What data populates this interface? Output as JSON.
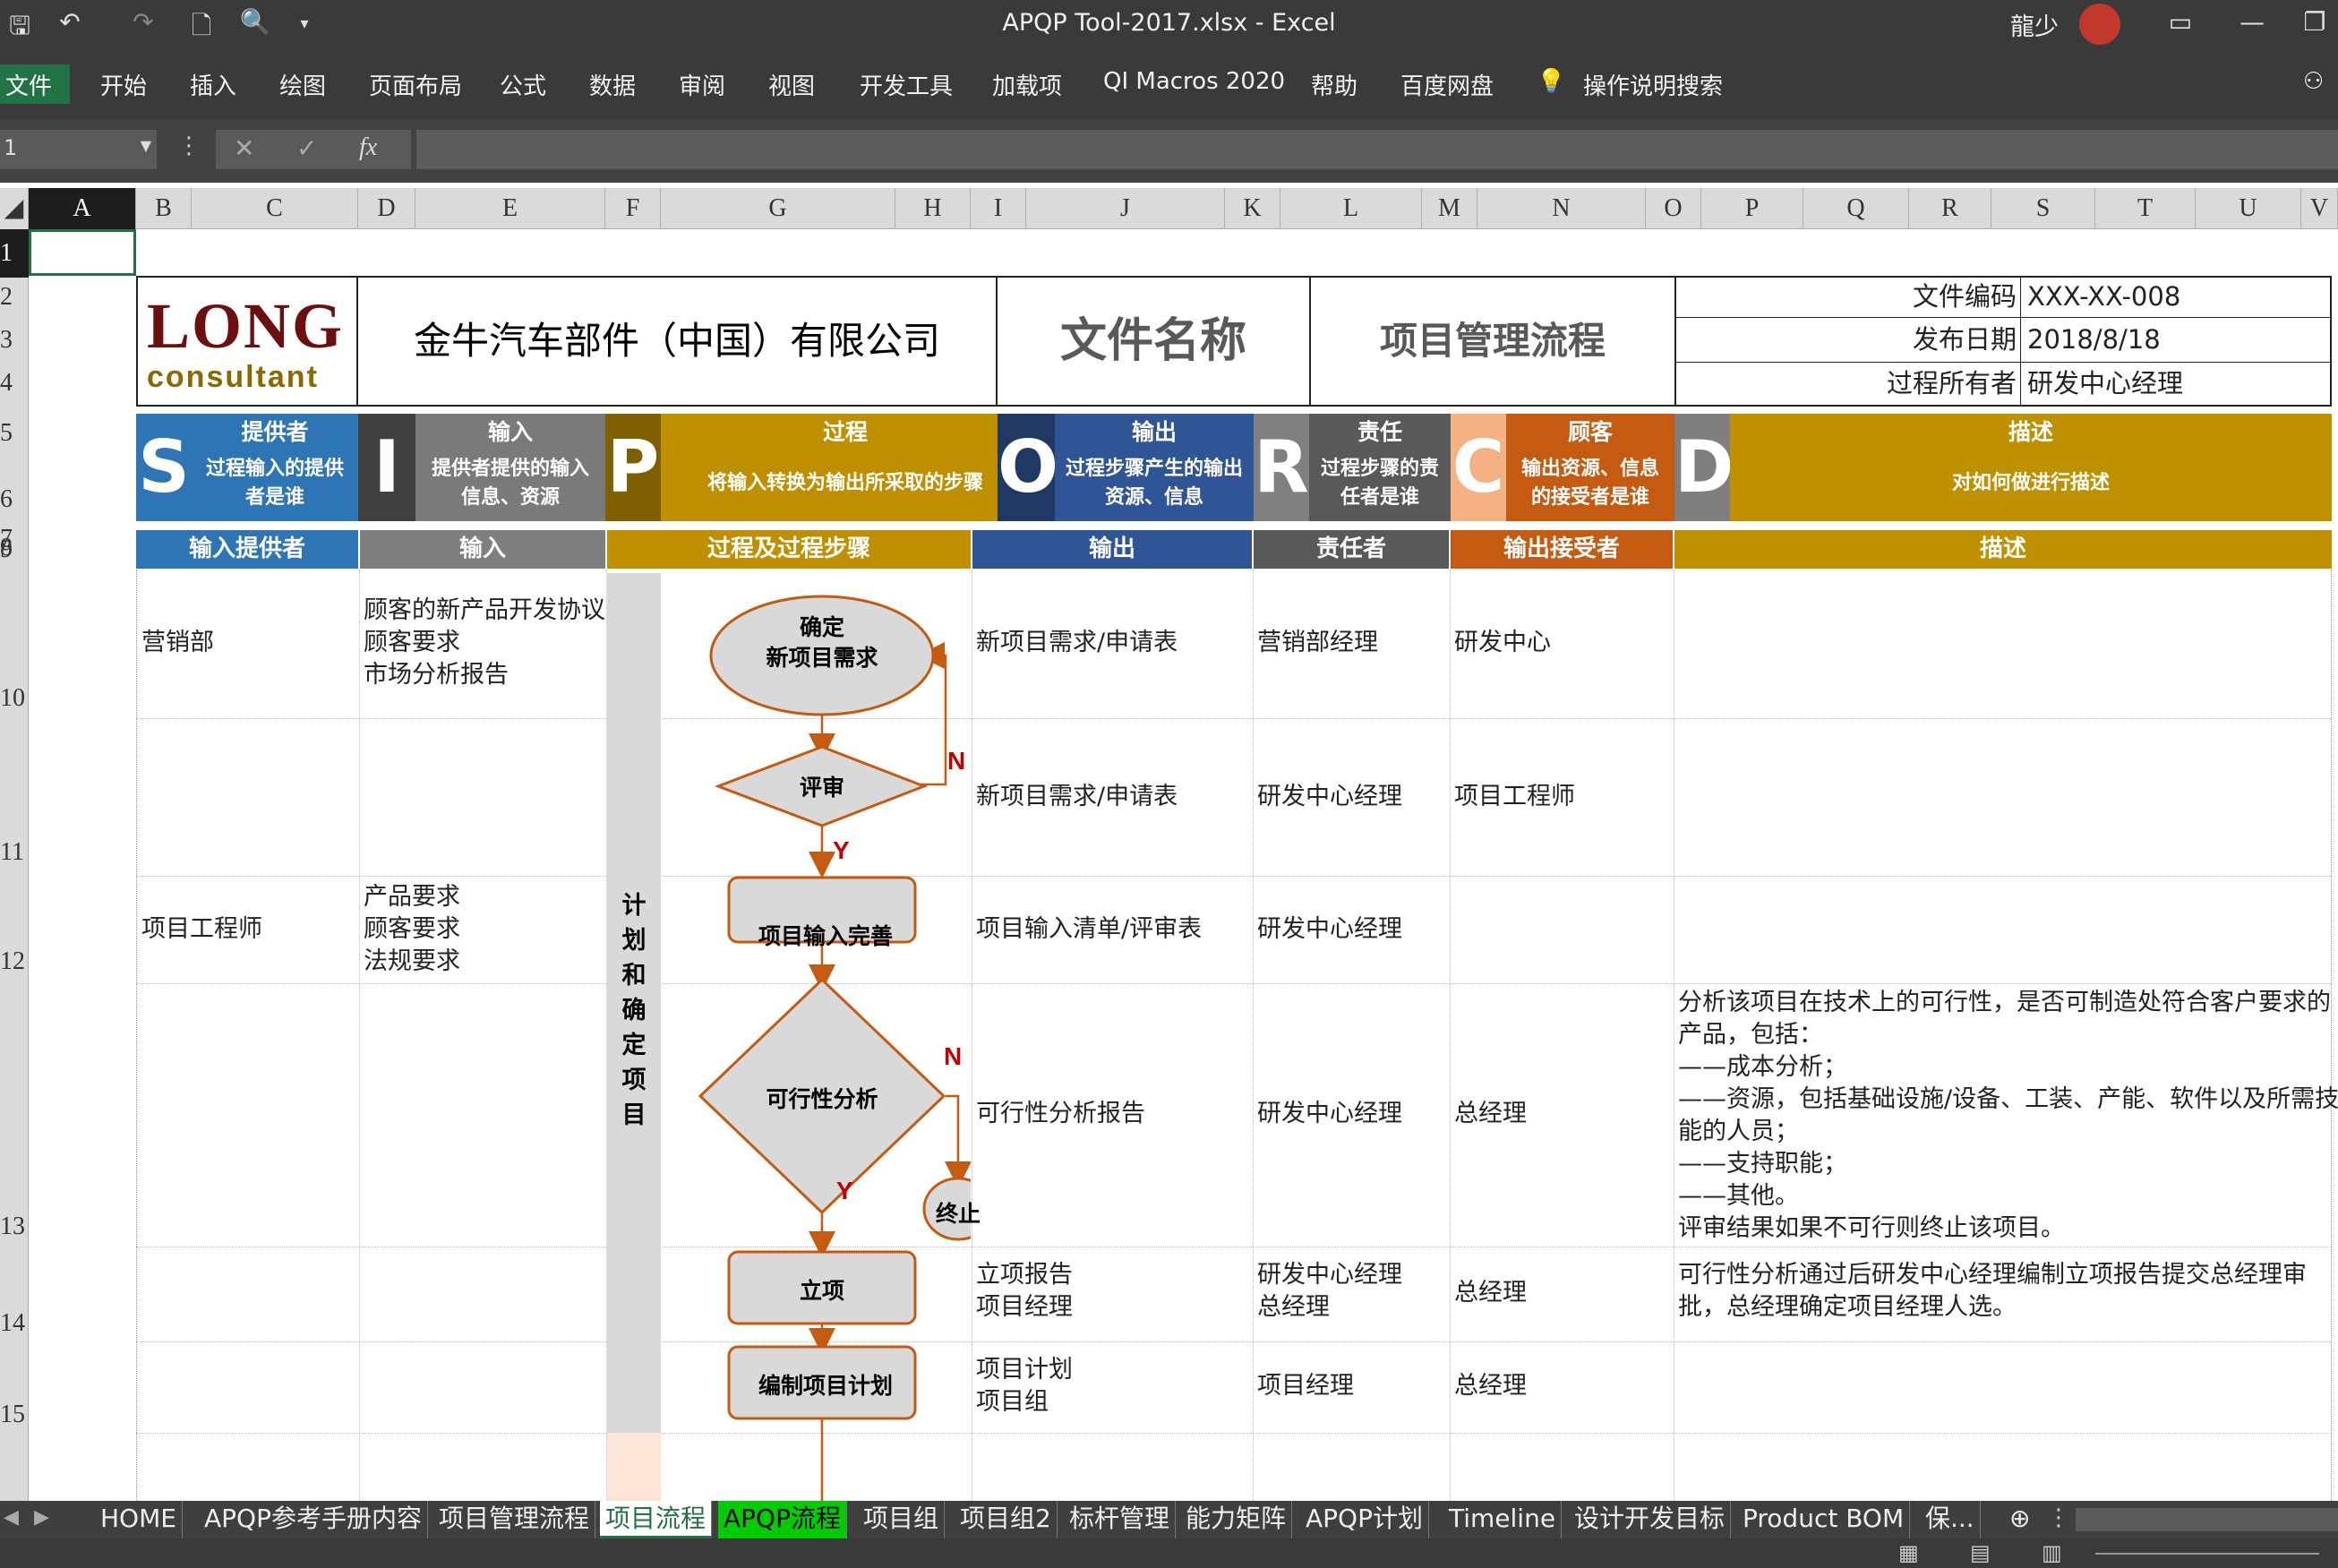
{
  "window": {
    "title": "APQP Tool-2017.xlsx  -  Excel",
    "user": "龍少"
  },
  "ribbon": {
    "tabs": [
      "文件",
      "开始",
      "插入",
      "绘图",
      "页面布局",
      "公式",
      "数据",
      "审阅",
      "视图",
      "开发工具",
      "加载项",
      "QI Macros 2020",
      "帮助",
      "百度网盘",
      "操作说明搜索"
    ]
  },
  "formula_bar": {
    "name_box": "1",
    "fx": "fx"
  },
  "columns": [
    "A",
    "B",
    "C",
    "D",
    "E",
    "F",
    "G",
    "H",
    "I",
    "J",
    "K",
    "L",
    "M",
    "N",
    "O",
    "P",
    "Q",
    "R",
    "S",
    "T",
    "U",
    "V"
  ],
  "rows": [
    "1",
    "2",
    "3",
    "4",
    "5",
    "6",
    "7",
    "8",
    "9",
    "10",
    "11",
    "12",
    "13",
    "14",
    "15"
  ],
  "header": {
    "logo_top": "LONG",
    "logo_bottom": "consultant",
    "company": "金牛汽车部件（中国）有限公司",
    "doc_name_label": "文件名称",
    "doc_name": "项目管理流程",
    "meta": [
      {
        "label": "文件编码",
        "value": "XXX-XX-008"
      },
      {
        "label": "发布日期",
        "value": "2018/8/18"
      },
      {
        "label": "过程所有者",
        "value": "研发中心经理"
      }
    ]
  },
  "sipoc": {
    "S": {
      "letter": "S",
      "title": "提供者",
      "desc": "过程输入的提供\n者是谁"
    },
    "I": {
      "letter": "I",
      "title": "输入",
      "desc": "提供者提供的输入\n信息、资源"
    },
    "P": {
      "letter": "P",
      "title": "过程",
      "desc": "将输入转换为输出所采取的步骤"
    },
    "O": {
      "letter": "O",
      "title": "输出",
      "desc": "过程步骤产生的输出\n资源、信息"
    },
    "R": {
      "letter": "R",
      "title": "责任",
      "desc": "过程步骤的责\n任者是谁"
    },
    "C": {
      "letter": "C",
      "title": "顾客",
      "desc": "输出资源、信息\n的接受者是谁"
    },
    "D": {
      "letter": "D",
      "title": "描述",
      "desc": "对如何做进行描述"
    }
  },
  "table_headers": [
    "输入提供者",
    "输入",
    "过程及过程步骤",
    "输出",
    "责任者",
    "输出接受者",
    "描述"
  ],
  "phase_label": "计\n划\n和\n确\n定\n项\n目",
  "rows_data": [
    {
      "supplier": "营销部",
      "input": "顾客的新产品开发协议\n顾客要求\n市场分析报告",
      "output": "新项目需求/申请表",
      "owner": "营销部经理",
      "receiver": "研发中心",
      "desc": ""
    },
    {
      "supplier": "",
      "input": "",
      "output": "新项目需求/申请表",
      "owner": "研发中心经理",
      "receiver": "项目工程师",
      "desc": ""
    },
    {
      "supplier": "项目工程师",
      "input": "产品要求\n顾客要求\n法规要求",
      "output": "项目输入清单/评审表",
      "owner": "研发中心经理",
      "receiver": "",
      "desc": ""
    },
    {
      "supplier": "",
      "input": "",
      "output": "可行性分析报告",
      "owner": "研发中心经理",
      "receiver": "总经理",
      "desc": "分析该项目在技术上的可行性，是否可制造处符合客户要求的\n产品，包括：\n——成本分析；\n——资源，包括基础设施/设备、工装、产能、软件以及所需技\n能的人员；\n——支持职能；\n——其他。\n评审结果如果不可行则终止该项目。"
    },
    {
      "supplier": "",
      "input": "",
      "output": "立项报告\n项目经理",
      "owner": "研发中心经理\n总经理",
      "receiver": "总经理",
      "desc": "可行性分析通过后研发中心经理编制立项报告提交总经理审\n批，总经理确定项目经理人选。"
    },
    {
      "supplier": "",
      "input": "",
      "output": "项目计划\n项目组",
      "owner": "项目经理",
      "receiver": "总经理",
      "desc": ""
    }
  ],
  "flow": {
    "start": "确定\n新项目需求",
    "review": "评审",
    "input_complete": "项目输入完善",
    "feasibility": "可行性分析",
    "end": "终止",
    "approve": "立项",
    "plan": "编制项目计划",
    "yes": "Y",
    "no": "N"
  },
  "sheet_tabs": [
    "HOME",
    "APQP参考手册内容",
    "项目管理流程",
    "项目流程",
    "APQP流程",
    "项目组",
    "项目组2",
    "标杆管理",
    "能力矩阵",
    "APQP计划",
    "Timeline",
    "设计开发目标",
    "Product BOM",
    "保...",
    "⊕"
  ],
  "colors": {
    "S": "#2e75b6",
    "I": "#595959",
    "P": "#bf8f00",
    "O": "#203864",
    "R": "#7f7f7f",
    "C": "#e46c0a",
    "D": "#bf9000",
    "excel_green": "#217346",
    "flow_stroke": "#c55a11"
  }
}
